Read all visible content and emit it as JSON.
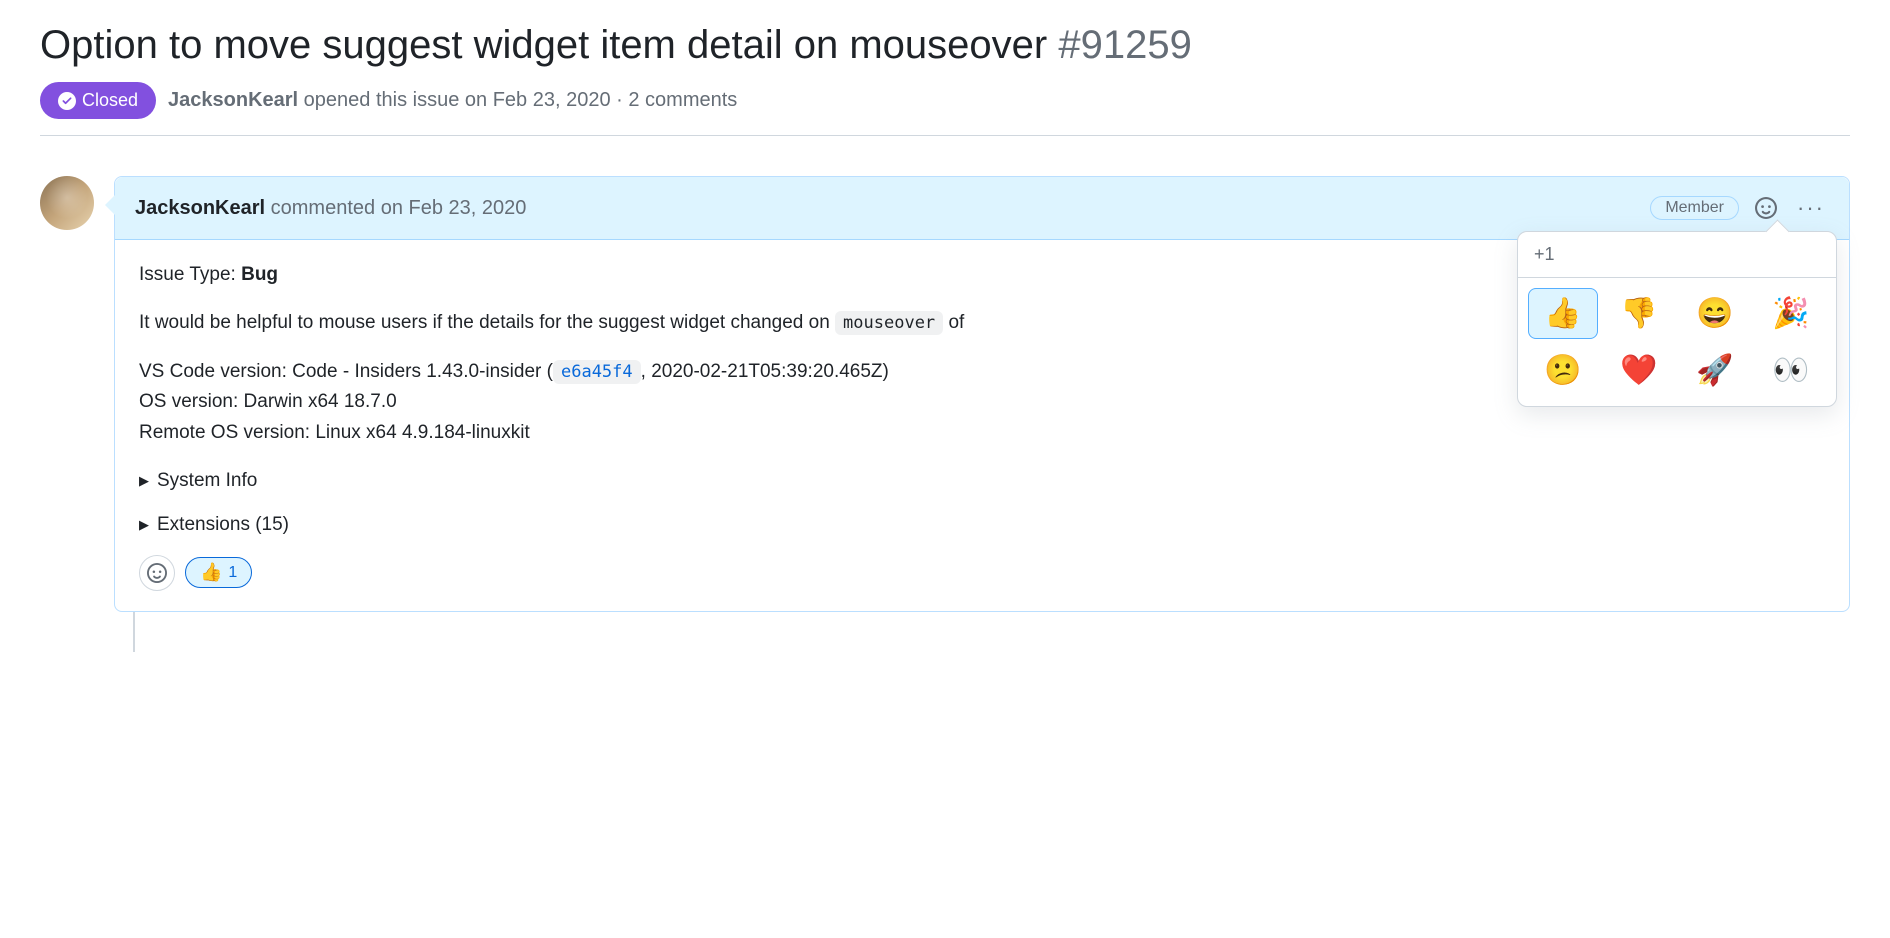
{
  "issue": {
    "title": "Option to move suggest widget item detail on mouseover",
    "number": "#91259",
    "status": "Closed",
    "author": "JacksonKearl",
    "opened_text": "opened this issue on Feb 23, 2020",
    "comments_text": "2 comments"
  },
  "comment": {
    "author": "JacksonKearl",
    "action": "commented",
    "date": "on Feb 23, 2020",
    "role": "Member",
    "issue_type_label": "Issue Type:",
    "issue_type_value": "Bug",
    "body_line1_pre": "It would be helpful to mouse users if the details for the suggest widget changed on ",
    "body_line1_code": "mouseover",
    "body_line1_post": " of",
    "vscode_line_pre": "VS Code version: Code - Insiders 1.43.0-insider (",
    "vscode_commit": "e6a45f4",
    "vscode_line_post": ", 2020-02-21T05:39:20.465Z)",
    "os_line": "OS version: Darwin x64 18.7.0",
    "remote_line": "Remote OS version: Linux x64 4.9.184-linuxkit",
    "details": {
      "system_info": "System Info",
      "extensions": "Extensions (15)"
    },
    "reactions": {
      "thumbs_up_emoji": "👍",
      "thumbs_up_count": "1"
    }
  },
  "popover": {
    "header": "+1",
    "emojis": [
      "👍",
      "👎",
      "😄",
      "🎉",
      "😕",
      "❤️",
      "🚀",
      "👀"
    ]
  }
}
